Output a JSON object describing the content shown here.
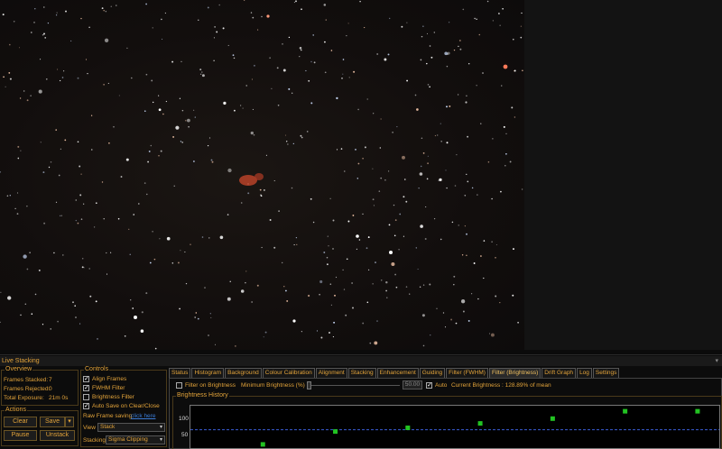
{
  "panel": {
    "title": "Live Stacking",
    "pin_icon": "pin-icon"
  },
  "overview": {
    "legend": "Overview",
    "frames_stacked_label": "Frames Stacked:",
    "frames_stacked_value": "7",
    "frames_rejected_label": "Frames Rejected:",
    "frames_rejected_value": "0",
    "total_exposure_label": "Total Exposure:",
    "total_exposure_value": "21m 0s"
  },
  "actions": {
    "legend": "Actions",
    "clear": "Clear",
    "save": "Save",
    "pause": "Pause",
    "unstack": "Unstack"
  },
  "controls": {
    "legend": "Controls",
    "align_frames": "Align Frames",
    "fwhm_filter": "FWHM Filter",
    "brightness_filter": "Brightness Filter",
    "auto_save": "Auto Save on Clear/Close",
    "raw_frame_saving_label": "Raw Frame saving",
    "raw_frame_saving_link": "click here",
    "view_label": "View",
    "view_value": "Stack",
    "stacking_label": "Stacking",
    "stacking_value": "Sigma Clipping"
  },
  "tabs": [
    "Status",
    "Histogram",
    "Background",
    "Colour Calibration",
    "Alignment",
    "Stacking",
    "Enhancement",
    "Guiding",
    "Filter (FWHM)",
    "Filter (Brightness)",
    "Drift Graph",
    "Log",
    "Settings"
  ],
  "active_tab": "Filter (Brightness)",
  "brightness": {
    "filter_on_brightness": "Filter on Brightness",
    "minimum_brightness_label": "Minimum Brightness (%)",
    "minimum_value": "50.00",
    "auto_label": "Auto",
    "current_brightness": "Current Brightness : 128.89% of mean",
    "history_legend": "Brightness History"
  },
  "chart_data": {
    "type": "scatter",
    "title": "Brightness History",
    "yticks": [
      "100",
      "50"
    ],
    "threshold": 50,
    "ylim": [
      0,
      115
    ],
    "points": [
      [
        1,
        10
      ],
      [
        2,
        45
      ],
      [
        3,
        55
      ],
      [
        4,
        67
      ],
      [
        5,
        80
      ],
      [
        6,
        100
      ],
      [
        7,
        100
      ]
    ],
    "xlim": [
      0,
      7.3
    ],
    "colors": {
      "points": "#22c322",
      "threshold": "#3a5bd5"
    }
  }
}
